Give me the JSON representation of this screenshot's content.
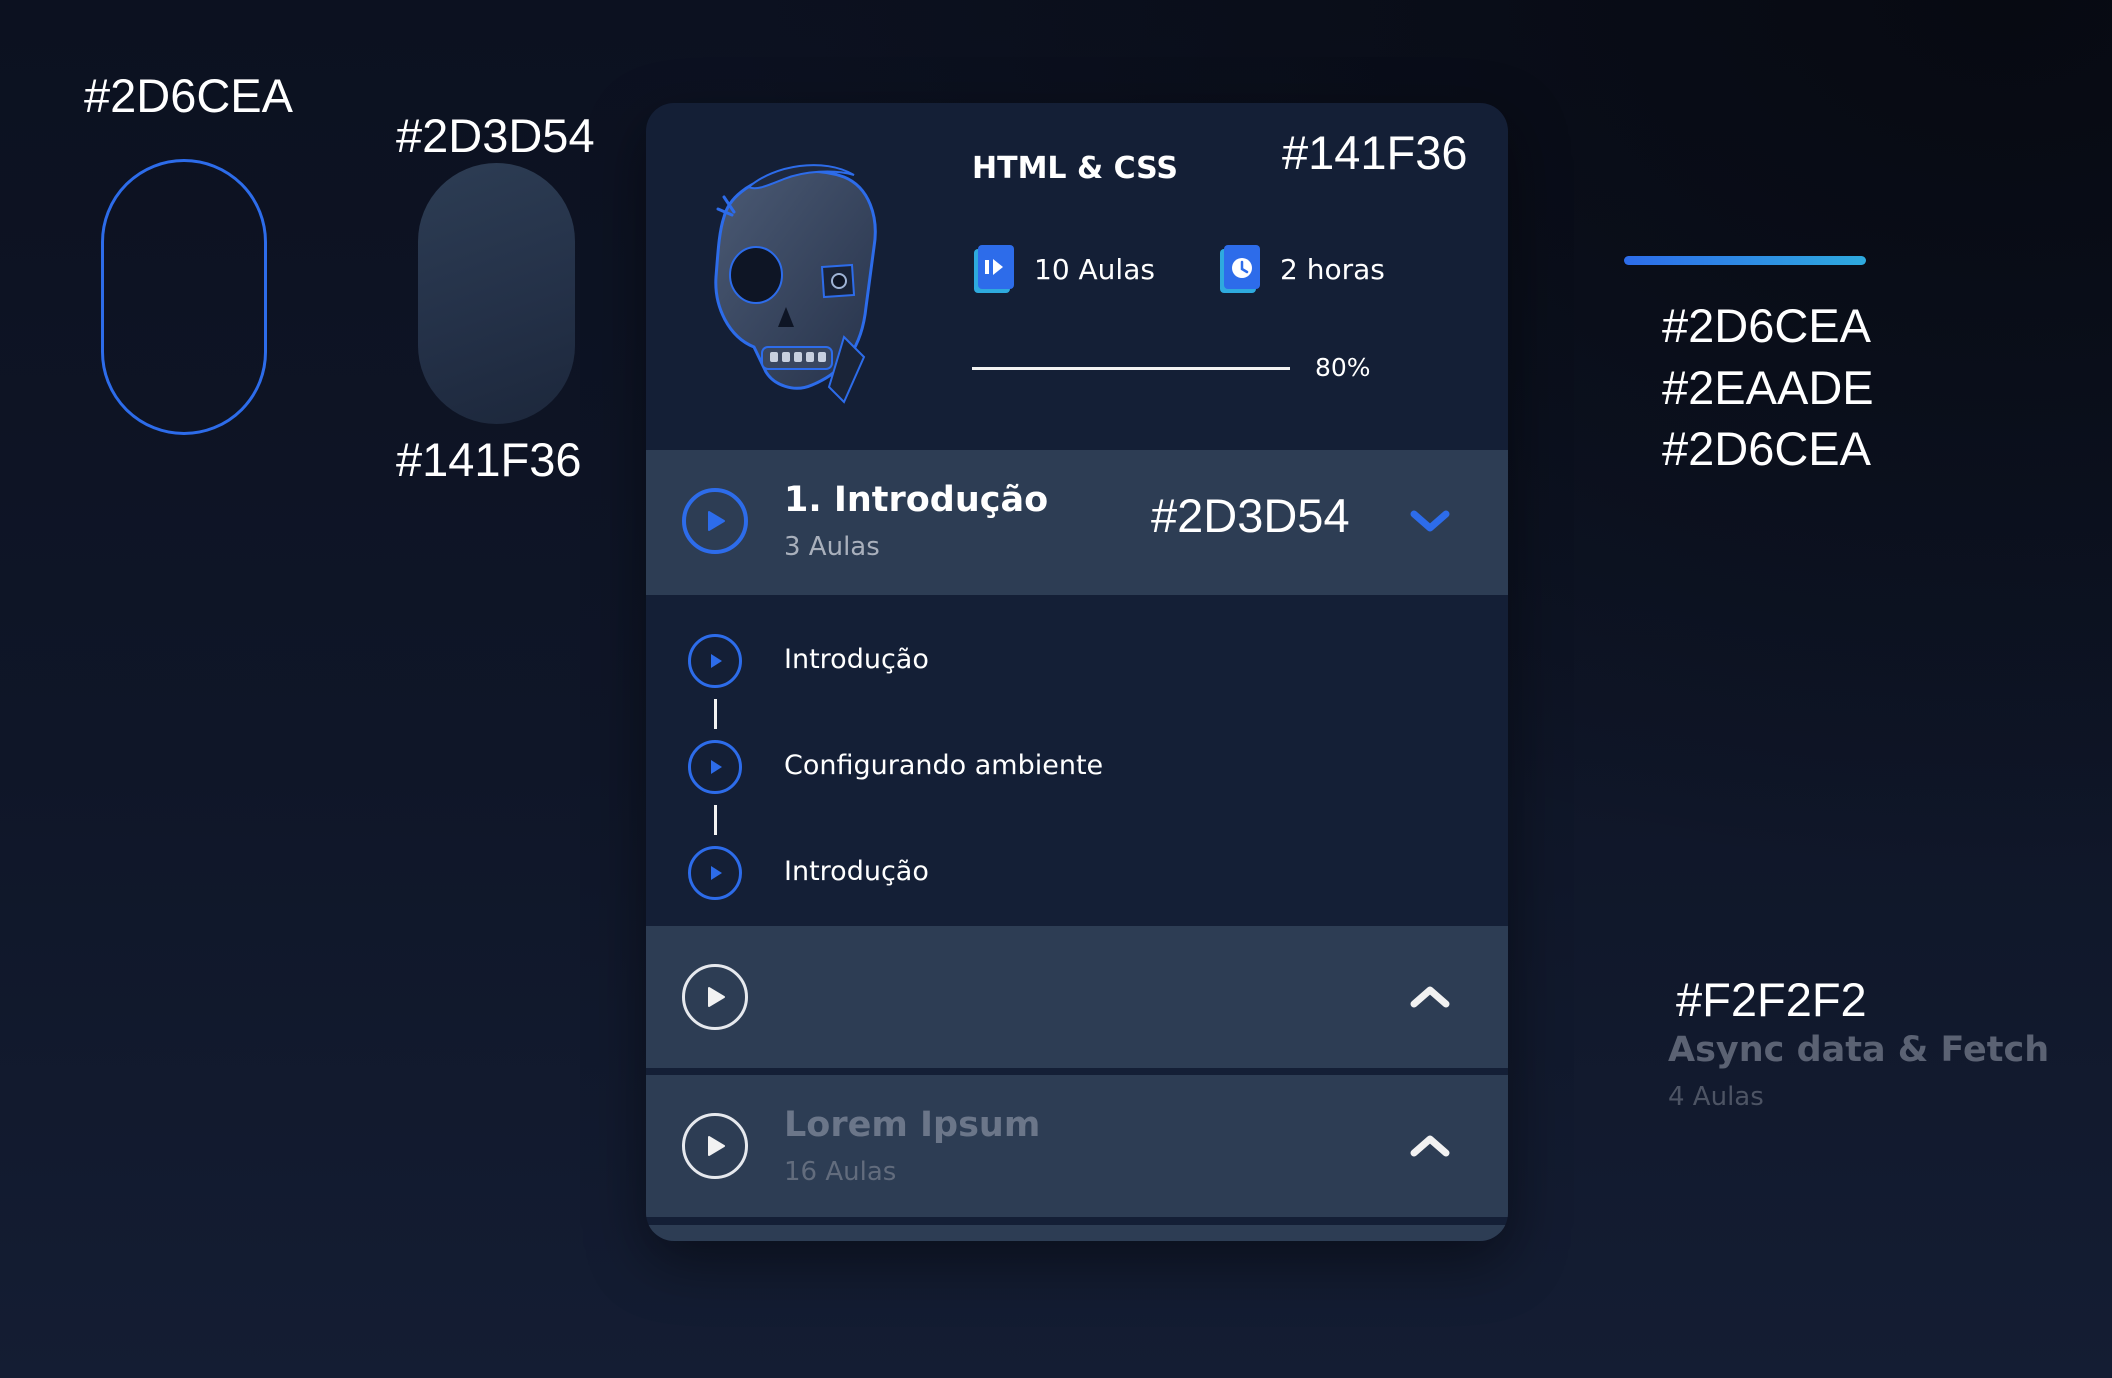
{
  "palette": {
    "outline_hex": "#2D6CEA",
    "fill_hex_top": "#2D3D54",
    "fill_hex_bottom": "#141F36",
    "gradient_hex": [
      "#2D6CEA",
      "#2EAADE",
      "#2D6CEA"
    ],
    "text_hex": "#F2F2F2"
  },
  "card": {
    "background_hex": "#141F36",
    "course_title": "HTML & CSS",
    "stats": {
      "lessons": "10 Aulas",
      "duration": "2 horas",
      "lessons_icon": "video-book-icon",
      "duration_icon": "clock-book-icon"
    },
    "progress": {
      "value": 0.8,
      "label": "80%"
    },
    "hero_icon": "skull-cyborg-illustration"
  },
  "sections": [
    {
      "title": "1. Introdução",
      "subtitle": "3 Aulas",
      "background_hex": "#2D3D54",
      "expanded": true,
      "lessons": [
        {
          "label": "Introdução"
        },
        {
          "label": "Configurando ambiente"
        },
        {
          "label": "Introdução"
        }
      ]
    },
    {
      "title": "Async data & Fetch",
      "subtitle": "4 Aulas",
      "title_color_hex": "#F2F2F2",
      "expanded": false
    },
    {
      "title": "Lorem Ipsum",
      "subtitle": "16 Aulas",
      "expanded": false
    }
  ],
  "colors": {
    "accent": "#2D6CEA",
    "accent_secondary": "#2EAADE",
    "section_bg": "#2D3D54",
    "card_bg": "#141F36",
    "text_light": "#F2F2F2"
  }
}
